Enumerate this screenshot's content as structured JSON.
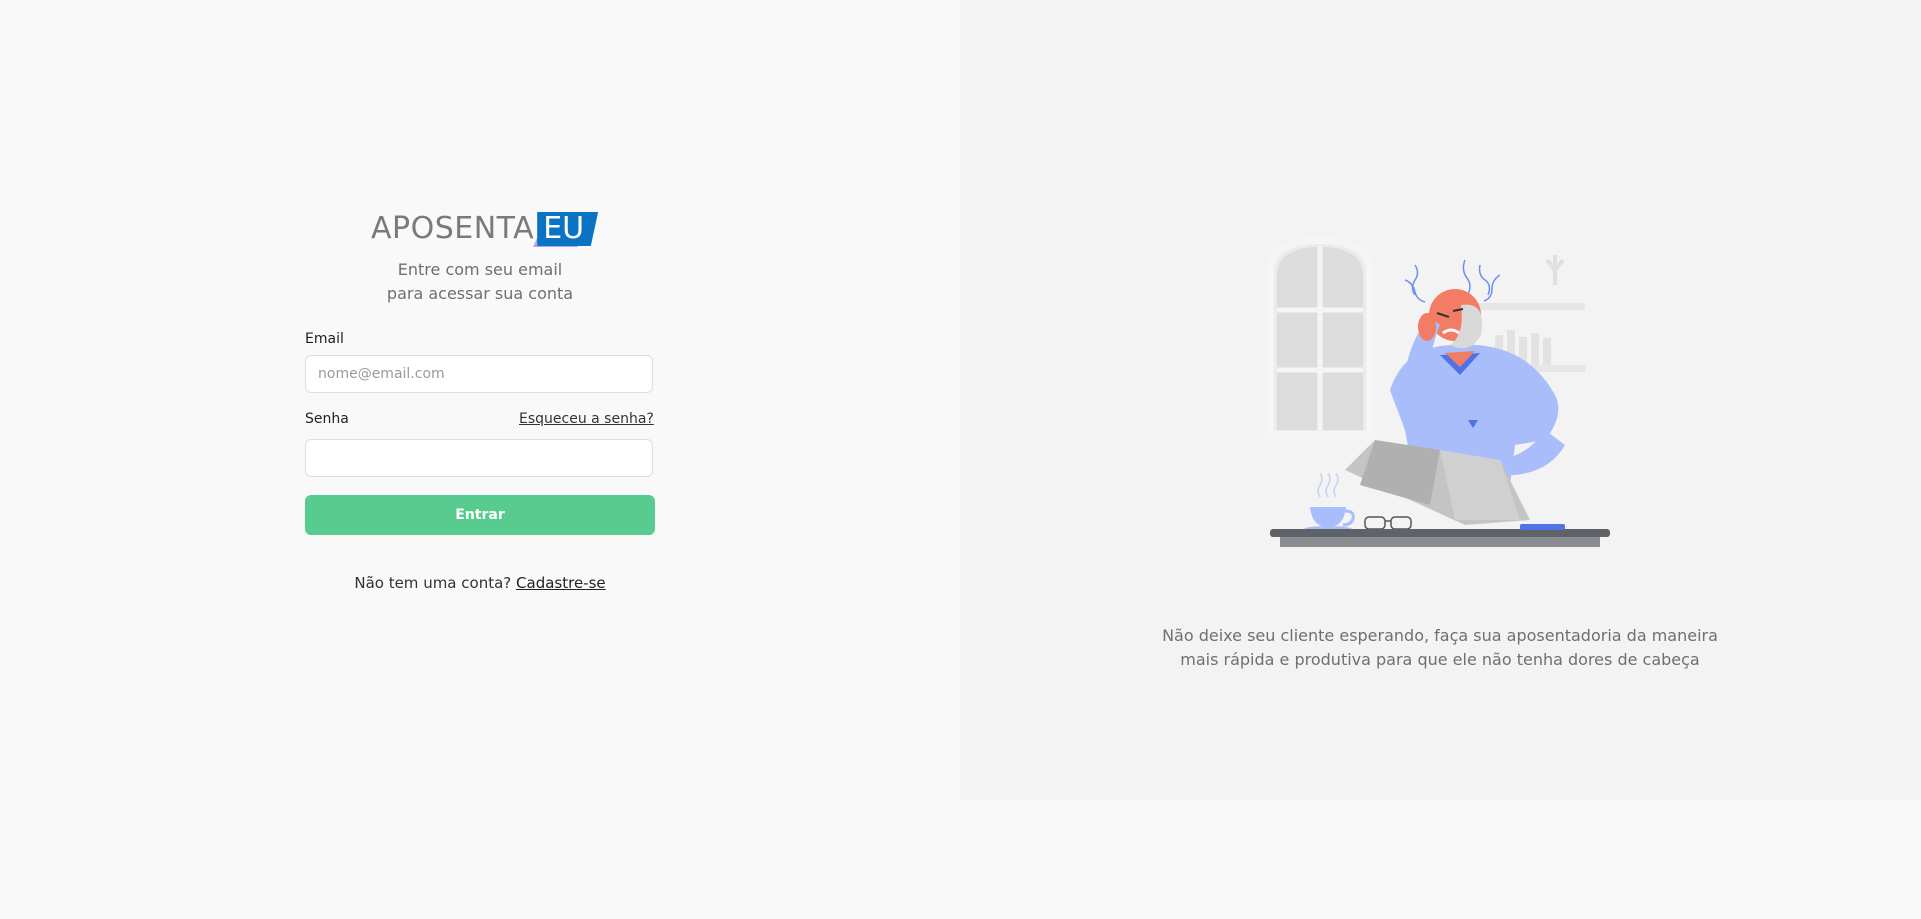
{
  "brand": {
    "logo_main": "APOSENTA",
    "logo_accent": "EU",
    "accent_color": "#0a73c4"
  },
  "login": {
    "subtitle_line1": "Entre com seu email",
    "subtitle_line2": "para acessar sua conta",
    "email_label": "Email",
    "email_placeholder": "nome@email.com",
    "email_value": "",
    "password_label": "Senha",
    "password_value": "",
    "forgot_label": "Esqueceu a senha?",
    "submit_label": "Entrar",
    "submit_color": "#58cc8f",
    "signup_prompt": "Não tem uma conta?",
    "signup_link": "Cadastre-se"
  },
  "hero": {
    "illustration": "stressed-man-reading-newspaper-illustration",
    "tagline_line1": "Não deixe seu cliente esperando, faça sua aposentadoria da maneira",
    "tagline_line2": "mais rápida e produtiva para que ele não tenha dores de cabeça"
  }
}
